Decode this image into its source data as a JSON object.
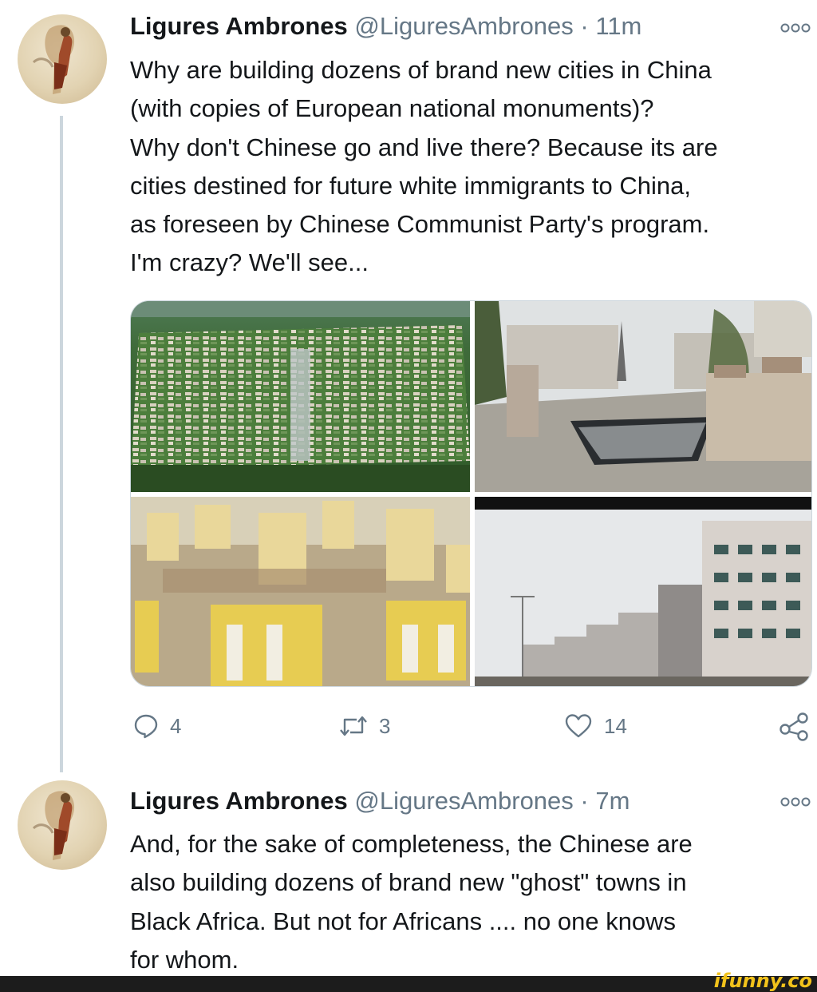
{
  "tweets": [
    {
      "name": "Ligures Ambrones",
      "handle": "@LiguresAmbrones",
      "separator": "·",
      "time": "11m",
      "lines": [
        "Why are building dozens of brand new cities in China",
        "(with copies of European national monuments)?",
        "Why don't Chinese go and live there? Because its are",
        "cities destined for future white immigrants to China,",
        "as foreseen by Chinese Communist Party's program.",
        "I'm crazy? We'll see..."
      ],
      "actions": {
        "reply_count": "4",
        "retweet_count": "3",
        "like_count": "14"
      }
    },
    {
      "name": "Ligures Ambrones",
      "handle": "@LiguresAmbrones",
      "separator": "·",
      "time": "7m",
      "lines": [
        "And, for the sake of completeness, the Chinese are",
        "also building dozens of brand new \"ghost\" towns in",
        "Black Africa. But not for Africans .... no one knows",
        "for whom."
      ]
    }
  ],
  "watermark": "ifunny.co",
  "colors": {
    "text": "#14171a",
    "secondary": "#657786",
    "thread_line": "#ccd6dd",
    "watermark": "#f2c21b"
  }
}
